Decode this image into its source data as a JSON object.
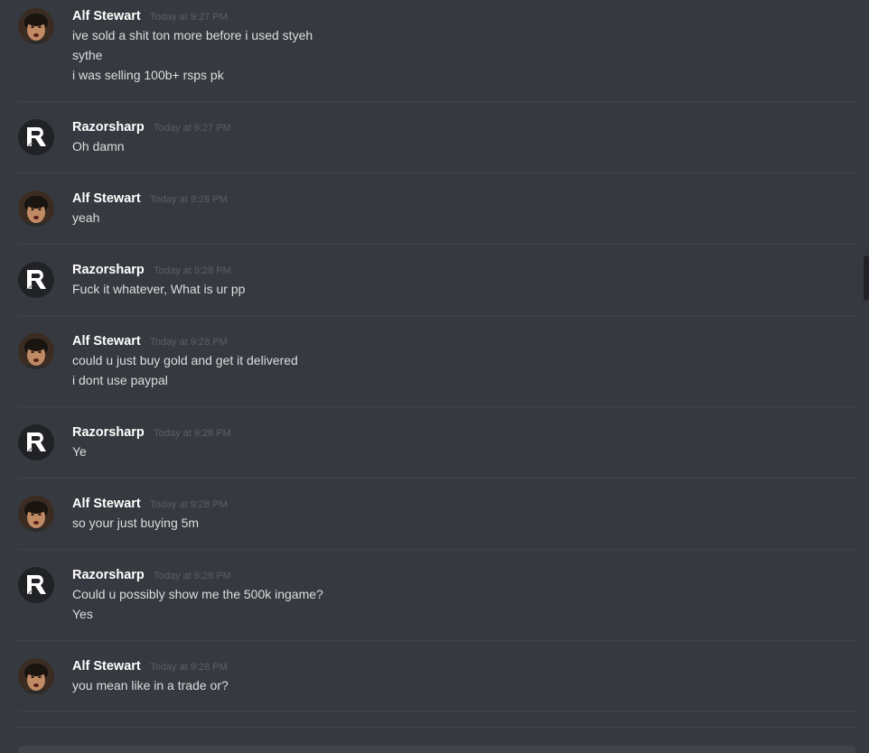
{
  "users": {
    "alf": {
      "name": "Alf Stewart",
      "avatar_icon": "profile-photo-icon"
    },
    "razor": {
      "name": "Razorsharp",
      "avatar_icon": "r-logo-icon"
    }
  },
  "messages": [
    {
      "author": "Alf Stewart",
      "timestamp": "Today at 9:27 PM",
      "lines": [
        "ive sold a shit ton more before i used styeh",
        "sythe",
        "i was selling 100b+ rsps pk"
      ]
    },
    {
      "author": "Razorsharp",
      "timestamp": "Today at 9:27 PM",
      "lines": [
        "Oh damn"
      ]
    },
    {
      "author": "Alf Stewart",
      "timestamp": "Today at 9:28 PM",
      "lines": [
        "yeah"
      ]
    },
    {
      "author": "Razorsharp",
      "timestamp": "Today at 9:28 PM",
      "lines": [
        "Fuck it whatever, What is ur pp"
      ]
    },
    {
      "author": "Alf Stewart",
      "timestamp": "Today at 9:28 PM",
      "lines": [
        "could u just buy gold and get it delivered",
        "i dont use paypal"
      ]
    },
    {
      "author": "Razorsharp",
      "timestamp": "Today at 9:28 PM",
      "lines": [
        "Ye"
      ]
    },
    {
      "author": "Alf Stewart",
      "timestamp": "Today at 9:28 PM",
      "lines": [
        "so your just buying 5m"
      ]
    },
    {
      "author": "Razorsharp",
      "timestamp": "Today at 9:28 PM",
      "lines": [
        "Could u possibly show me the 500k ingame?",
        "Yes"
      ]
    },
    {
      "author": "Alf Stewart",
      "timestamp": "Today at 9:28 PM",
      "lines": [
        "you mean like in a trade or?"
      ]
    }
  ],
  "colors": {
    "background": "#36393f",
    "username": "#ffffff",
    "text": "#dcddde",
    "timestamp": "#5c5f66",
    "divider": "#41444a"
  }
}
